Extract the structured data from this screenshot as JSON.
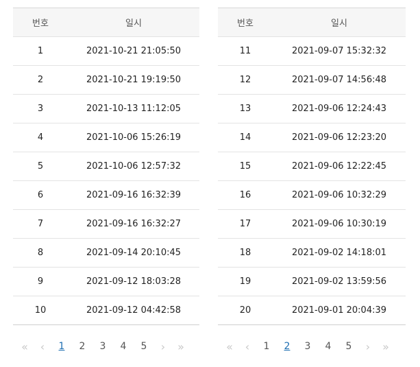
{
  "left_table": {
    "headers": {
      "number": "번호",
      "datetime": "일시"
    },
    "rows": [
      {
        "number": "1",
        "datetime": "2021-10-21 21:05:50"
      },
      {
        "number": "2",
        "datetime": "2021-10-21 19:19:50"
      },
      {
        "number": "3",
        "datetime": "2021-10-13 11:12:05"
      },
      {
        "number": "4",
        "datetime": "2021-10-06 15:26:19"
      },
      {
        "number": "5",
        "datetime": "2021-10-06 12:57:32"
      },
      {
        "number": "6",
        "datetime": "2021-09-16 16:32:39"
      },
      {
        "number": "7",
        "datetime": "2021-09-16 16:32:27"
      },
      {
        "number": "8",
        "datetime": "2021-09-14 20:10:45"
      },
      {
        "number": "9",
        "datetime": "2021-09-12 18:03:28"
      },
      {
        "number": "10",
        "datetime": "2021-09-12 04:42:58"
      }
    ],
    "pagination": {
      "first_icon": "double-chevron-left-icon",
      "prev_icon": "chevron-left-icon",
      "pages": [
        "1",
        "2",
        "3",
        "4",
        "5"
      ],
      "current_page": "1",
      "next_icon": "chevron-right-icon",
      "last_icon": "double-chevron-right-icon"
    }
  },
  "right_table": {
    "headers": {
      "number": "번호",
      "datetime": "일시"
    },
    "rows": [
      {
        "number": "11",
        "datetime": "2021-09-07 15:32:32"
      },
      {
        "number": "12",
        "datetime": "2021-09-07 14:56:48"
      },
      {
        "number": "13",
        "datetime": "2021-09-06 12:24:43"
      },
      {
        "number": "14",
        "datetime": "2021-09-06 12:23:20"
      },
      {
        "number": "15",
        "datetime": "2021-09-06 12:22:45"
      },
      {
        "number": "16",
        "datetime": "2021-09-06 10:32:29"
      },
      {
        "number": "17",
        "datetime": "2021-09-06 10:30:19"
      },
      {
        "number": "18",
        "datetime": "2021-09-02 14:18:01"
      },
      {
        "number": "19",
        "datetime": "2021-09-02 13:59:56"
      },
      {
        "number": "20",
        "datetime": "2021-09-01 20:04:39"
      }
    ],
    "pagination": {
      "first_icon": "double-chevron-left-icon",
      "prev_icon": "chevron-left-icon",
      "pages": [
        "1",
        "2",
        "3",
        "4",
        "5"
      ],
      "current_page": "2",
      "next_icon": "chevron-right-icon",
      "last_icon": "double-chevron-right-icon"
    }
  },
  "colors": {
    "header_bg": "#f6f6f6",
    "row_border": "#e3e3e3",
    "active_page": "#1f6fb2",
    "arrow_disabled": "#c8c8c8",
    "text": "#222222"
  }
}
